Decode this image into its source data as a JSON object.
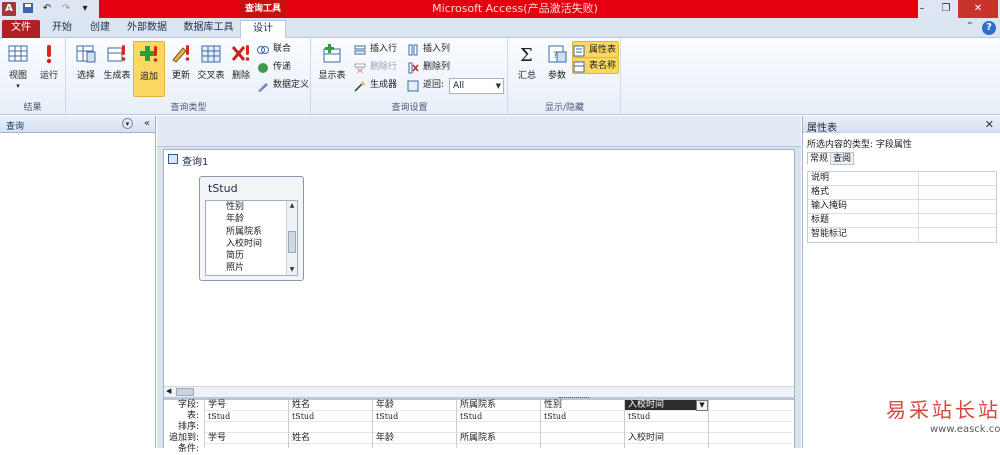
{
  "titlebar": {
    "context_tab": "查询工具",
    "app_title": "Microsoft Access(产品激活失败)"
  },
  "tabs": [
    {
      "label": "文件"
    },
    {
      "label": "开始"
    },
    {
      "label": "创建"
    },
    {
      "label": "外部数据"
    },
    {
      "label": "数据库工具"
    },
    {
      "label": "设计"
    }
  ],
  "ribbon": {
    "results": {
      "label": "结果",
      "view": "视图",
      "run": "运行"
    },
    "query_type": {
      "label": "查询类型",
      "select": "选择",
      "make_table": "生成表",
      "append": "追加",
      "update": "更新",
      "crosstab": "交叉表",
      "delete": "删除",
      "union": "联合",
      "pass_through": "传递",
      "data_definition": "数据定义"
    },
    "query_setup": {
      "label": "查询设置",
      "show_table": "显示表",
      "insert_rows": "插入行",
      "delete_rows": "删除行",
      "builder": "生成器",
      "insert_columns": "插入列",
      "delete_columns": "删除列",
      "return_label": "返回:",
      "return_value": "All"
    },
    "show_hide": {
      "label": "显示/隐藏",
      "totals": "汇总",
      "parameters": "参数",
      "property_sheet": "属性表",
      "table_names": "表名称"
    }
  },
  "nav": {
    "title": "查询"
  },
  "query": {
    "title": "查询1",
    "table": {
      "name": "tStud",
      "fields": [
        "性别",
        "年龄",
        "所属院系",
        "入校时间",
        "简历",
        "照片"
      ]
    },
    "row_labels": [
      "字段:",
      "表:",
      "排序:",
      "追加到:",
      "条件:"
    ],
    "columns": [
      {
        "field": "学号",
        "table": "tStud",
        "append_to": "学号"
      },
      {
        "field": "姓名",
        "table": "tStud",
        "append_to": "姓名"
      },
      {
        "field": "年龄",
        "table": "tStud",
        "append_to": "年龄"
      },
      {
        "field": "所属院系",
        "table": "tStud",
        "append_to": "所属院系"
      },
      {
        "field": "性别",
        "table": "tStud",
        "append_to": ""
      },
      {
        "field": "入校时间",
        "table": "tStud",
        "append_to": "入校时间"
      },
      {
        "field": "",
        "table": "",
        "append_to": ""
      }
    ]
  },
  "property_sheet": {
    "title": "属性表",
    "selection_type": "所选内容的类型:  字段属性",
    "tabs": [
      "常规",
      "查阅"
    ],
    "rows": [
      "说明",
      "格式",
      "输入掩码",
      "标题",
      "智能标记"
    ]
  },
  "watermark": {
    "cn": "易采站长站",
    "en": "www.easck.com"
  }
}
